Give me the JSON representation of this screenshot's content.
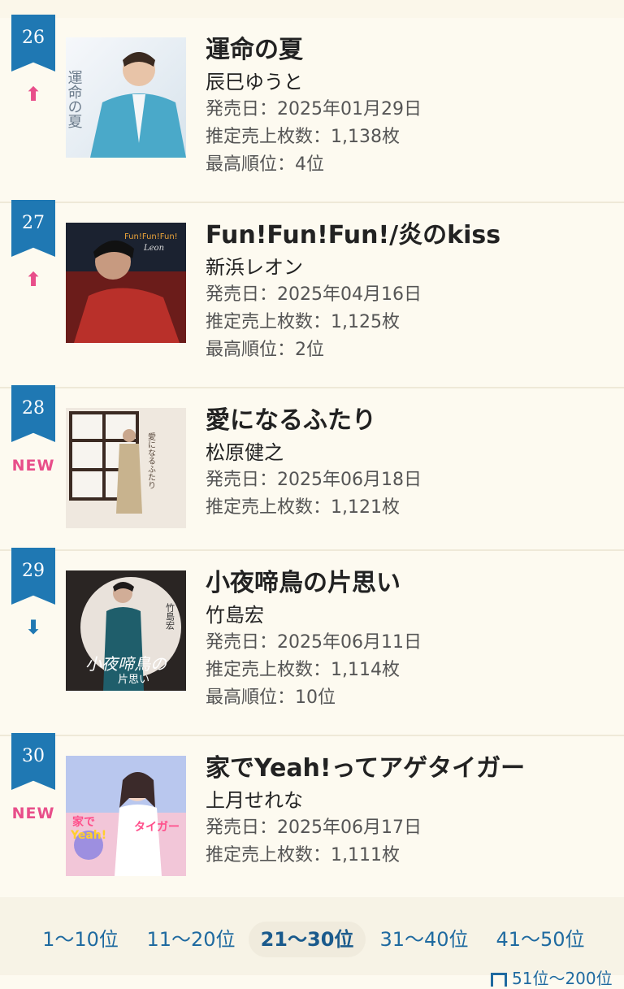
{
  "label_release": "発売日：",
  "label_sales": "推定売上枚数：",
  "label_peak": "最高順位：",
  "entries": [
    {
      "rank": "26",
      "movement": "up",
      "movement_text": "⬆",
      "title": "運命の夏",
      "artist": "辰巳ゆうと",
      "release": "発売日：2025年01月29日",
      "sales": "推定売上枚数：1,138枚",
      "peak": "最高順位：4位"
    },
    {
      "rank": "27",
      "movement": "up",
      "movement_text": "⬆",
      "title": "Fun!Fun!Fun!/炎のkiss",
      "artist": "新浜レオン",
      "release": "発売日：2025年04月16日",
      "sales": "推定売上枚数：1,125枚",
      "peak": "最高順位：2位"
    },
    {
      "rank": "28",
      "movement": "new",
      "movement_text": "NEW",
      "title": "愛になるふたり",
      "artist": "松原健之",
      "release": "発売日：2025年06月18日",
      "sales": "推定売上枚数：1,121枚",
      "peak": ""
    },
    {
      "rank": "29",
      "movement": "down",
      "movement_text": "⬇",
      "title": "小夜啼鳥の片思い",
      "artist": "竹島宏",
      "release": "発売日：2025年06月11日",
      "sales": "推定売上枚数：1,114枚",
      "peak": "最高順位：10位"
    },
    {
      "rank": "30",
      "movement": "new",
      "movement_text": "NEW",
      "title": "家でYeah!ってアゲタイガー",
      "artist": "上月せれな",
      "release": "発売日：2025年06月17日",
      "sales": "推定売上枚数：1,111枚",
      "peak": ""
    }
  ],
  "pagination": {
    "pages": [
      "1〜10位",
      "11〜20位",
      "21〜30位",
      "31〜40位",
      "41〜50位"
    ],
    "active": "21〜30位",
    "more": "51位〜200位"
  },
  "colors": {
    "accent": "#1f78b3",
    "up": "#e84e8a",
    "new": "#e84e8a",
    "background": "#fdfaf0"
  }
}
